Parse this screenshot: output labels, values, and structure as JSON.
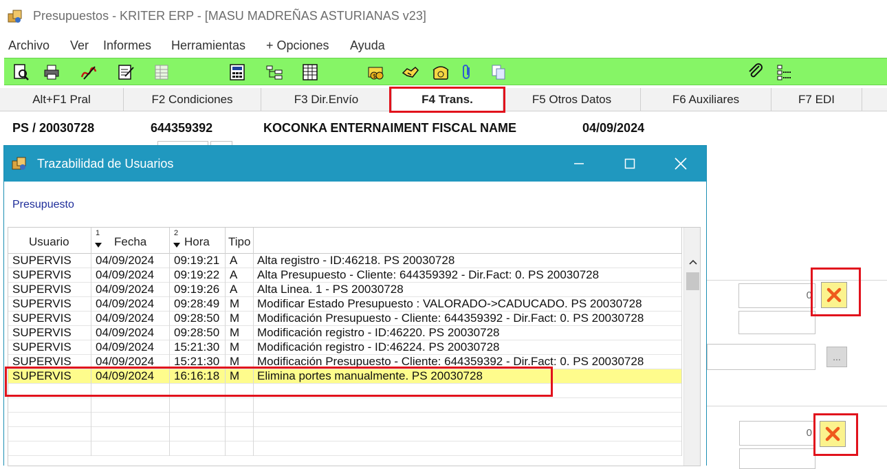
{
  "window": {
    "title": "Presupuestos - KRITER ERP - [MASU MADREÑAS ASTURIANAS v23]"
  },
  "menu": [
    "Archivo",
    "Ver",
    "Informes",
    "Herramientas",
    "+ Opciones",
    "Ayuda"
  ],
  "toolbar": {
    "buttons": [
      "preview-icon",
      "print-icon",
      "signature-icon",
      "edit-form-icon",
      "grid-icon",
      "calculator-icon",
      "tree-icon",
      "spreadsheet-icon",
      "coins-icon",
      "handshake-icon",
      "phone-icon",
      "paperclip-icon",
      "copy-icon",
      "attachment-icon",
      "list-icon"
    ],
    "background": "#86f566"
  },
  "tabs": [
    {
      "label": "Alt+F1 Pral",
      "active": false
    },
    {
      "label": "F2 Condiciones",
      "active": false
    },
    {
      "label": "F3 Dir.Envío",
      "active": false
    },
    {
      "label": "F4 Trans.",
      "active": true
    },
    {
      "label": "F5 Otros Datos",
      "active": false
    },
    {
      "label": "F6 Auxiliares",
      "active": false
    },
    {
      "label": "F7 EDI",
      "active": false
    }
  ],
  "document": {
    "number": "PS / 20030728",
    "client_code": "644359392",
    "client_name": "KOCONKA ENTERNAIMENT FISCAL NAME",
    "date": "04/09/2024"
  },
  "background_fields": {
    "amount_1": "0",
    "amount_2": "0",
    "ellipsis": "..."
  },
  "dialog": {
    "title": "Trazabilidad de Usuarios",
    "section_label": "Presupuesto",
    "columns": [
      {
        "label": "Usuario",
        "sort": ""
      },
      {
        "label": "Fecha",
        "sort": "1"
      },
      {
        "label": "Hora",
        "sort": "2"
      },
      {
        "label": "Tipo",
        "sort": ""
      },
      {
        "label": "",
        "sort": ""
      }
    ],
    "rows": [
      {
        "usuario": "SUPERVIS",
        "fecha": "04/09/2024",
        "hora": "09:19:21",
        "tipo": "A",
        "desc": "Alta registro - ID:46218.  PS 20030728"
      },
      {
        "usuario": "SUPERVIS",
        "fecha": "04/09/2024",
        "hora": "09:19:22",
        "tipo": "A",
        "desc": "Alta Presupuesto - Cliente: 644359392 - Dir.Fact: 0.  PS 20030728"
      },
      {
        "usuario": "SUPERVIS",
        "fecha": "04/09/2024",
        "hora": "09:19:26",
        "tipo": "A",
        "desc": "Alta Linea.  1 - PS 20030728"
      },
      {
        "usuario": "SUPERVIS",
        "fecha": "04/09/2024",
        "hora": "09:28:49",
        "tipo": "M",
        "desc": "Modificar Estado Presupuesto : VALORADO->CADUCADO.  PS 20030728"
      },
      {
        "usuario": "SUPERVIS",
        "fecha": "04/09/2024",
        "hora": "09:28:50",
        "tipo": "M",
        "desc": "Modificación Presupuesto - Cliente: 644359392 - Dir.Fact: 0.  PS 20030728"
      },
      {
        "usuario": "SUPERVIS",
        "fecha": "04/09/2024",
        "hora": "09:28:50",
        "tipo": "M",
        "desc": "Modificación registro - ID:46220.  PS 20030728"
      },
      {
        "usuario": "SUPERVIS",
        "fecha": "04/09/2024",
        "hora": "15:21:30",
        "tipo": "M",
        "desc": "Modificación registro - ID:46224.  PS 20030728"
      },
      {
        "usuario": "SUPERVIS",
        "fecha": "04/09/2024",
        "hora": "15:21:30",
        "tipo": "M",
        "desc": "Modificación Presupuesto - Cliente: 644359392 - Dir.Fact: 0.  PS 20030728"
      },
      {
        "usuario": "SUPERVIS",
        "fecha": "04/09/2024",
        "hora": "16:16:18",
        "tipo": "M",
        "desc": "Elimina portes manualmente.  PS 20030728"
      }
    ],
    "selected_row": 8,
    "empty_rows": 5,
    "title_color": "#2098bf",
    "selected_color": "#fefc8c"
  },
  "highlight_color": "#e1121c"
}
